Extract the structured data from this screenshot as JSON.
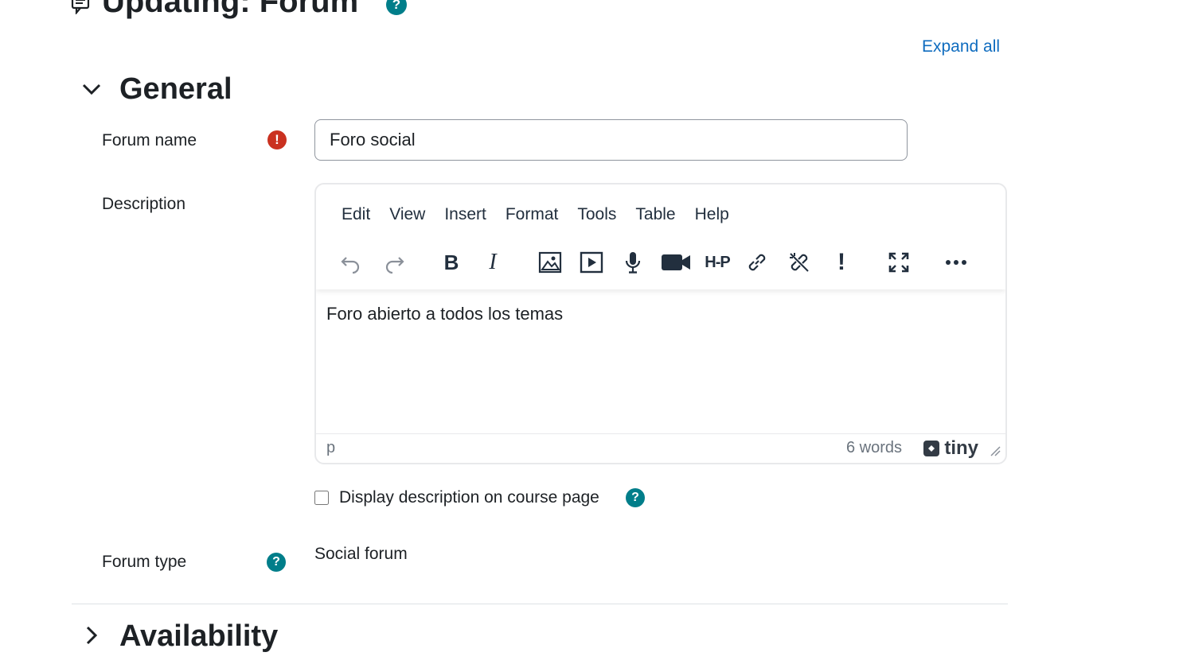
{
  "page": {
    "title": "Updating: Forum",
    "help_symbol": "?",
    "expand_all": "Expand all"
  },
  "general": {
    "heading": "General",
    "forum_name": {
      "label": "Forum name",
      "required_symbol": "!",
      "value": "Foro social"
    },
    "description": {
      "label": "Description",
      "menu": [
        "Edit",
        "View",
        "Insert",
        "Format",
        "Tools",
        "Table",
        "Help"
      ],
      "toolbar_icons": [
        "undo-icon",
        "redo-icon",
        "bold-icon",
        "italic-icon",
        "image-icon",
        "media-icon",
        "record-audio-icon",
        "record-video-icon",
        "h5p-icon",
        "link-icon",
        "unlink-icon",
        "accessibility-checker-icon",
        "fullscreen-icon",
        "more-icon"
      ],
      "bold_glyph": "B",
      "italic_glyph": "I",
      "h5p_glyph": "H-P",
      "exclamation_glyph": "!",
      "content": "Foro abierto a todos los temas",
      "status_path": "p",
      "word_count": "6 words",
      "brand": "tiny"
    },
    "display_description": {
      "label": "Display description on course page",
      "checked": false,
      "help_symbol": "?"
    },
    "forum_type": {
      "label": "Forum type",
      "help_symbol": "?",
      "value": "Social forum"
    }
  },
  "availability": {
    "heading": "Availability"
  },
  "colors": {
    "link": "#0f6cbf",
    "help": "#007e8a",
    "required": "#ca3120",
    "text": "#1d2125"
  }
}
